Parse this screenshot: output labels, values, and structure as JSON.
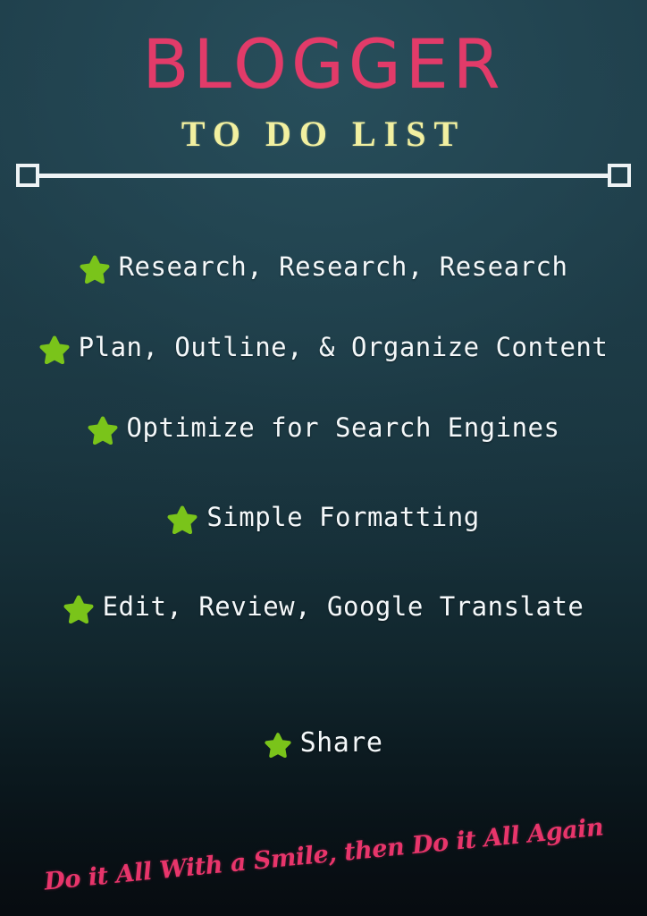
{
  "header": {
    "main_title": "BLOGGER",
    "subtitle": "TO DO LIST"
  },
  "divider": {
    "left_cap_icon": "square-outline-icon",
    "right_cap_icon": "square-outline-icon"
  },
  "list": {
    "bullet_icon": "star-icon",
    "items": [
      {
        "label": "Research, Research, Research"
      },
      {
        "label": "Plan, Outline, & Organize Content"
      },
      {
        "label": "Optimize for Search Engines"
      },
      {
        "label": "Simple Formatting"
      },
      {
        "label": "Edit, Review, Google Translate"
      },
      {
        "label": "Share"
      }
    ]
  },
  "footer": {
    "tagline": "Do it All With a Smile, then Do it All Again"
  },
  "colors": {
    "title_pink": "#e23b69",
    "subtitle_yellow": "#f2f0a0",
    "star_green": "#7ac41a",
    "list_text": "#f4f8fa",
    "divider_white": "#eef3f5",
    "background_top": "#1e3d49",
    "background_bottom": "#070c10",
    "tagline_pink": "#e8356b"
  }
}
